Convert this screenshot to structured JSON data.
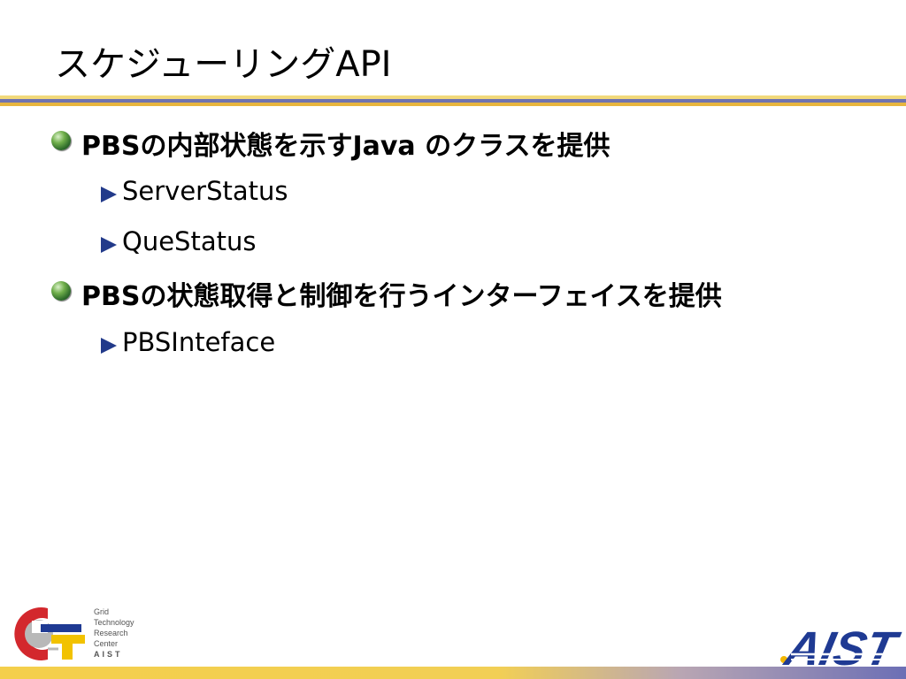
{
  "slide": {
    "title": "スケジューリングAPI",
    "bullets": [
      {
        "text": "PBSの内部状態を示すJava のクラスを提供",
        "children": [
          "ServerStatus",
          "QueStatus"
        ]
      },
      {
        "text": "PBSの状態取得と制御を行うインターフェイスを提供",
        "children": [
          "PBSInteface"
        ]
      }
    ]
  },
  "footer": {
    "gtrc_lines": [
      "Grid",
      "Technology",
      "Research",
      "Center",
      "AIST"
    ],
    "aist_logo_text": "AIST"
  },
  "colors": {
    "title_rule_top": "#f2d97a",
    "title_rule_mid": "#6f73b0",
    "title_rule_bottom": "#e7b53e",
    "bullet1": "#2d6a2a",
    "bullet2": "#223a8a",
    "aist_blue": "#1f3a93"
  }
}
